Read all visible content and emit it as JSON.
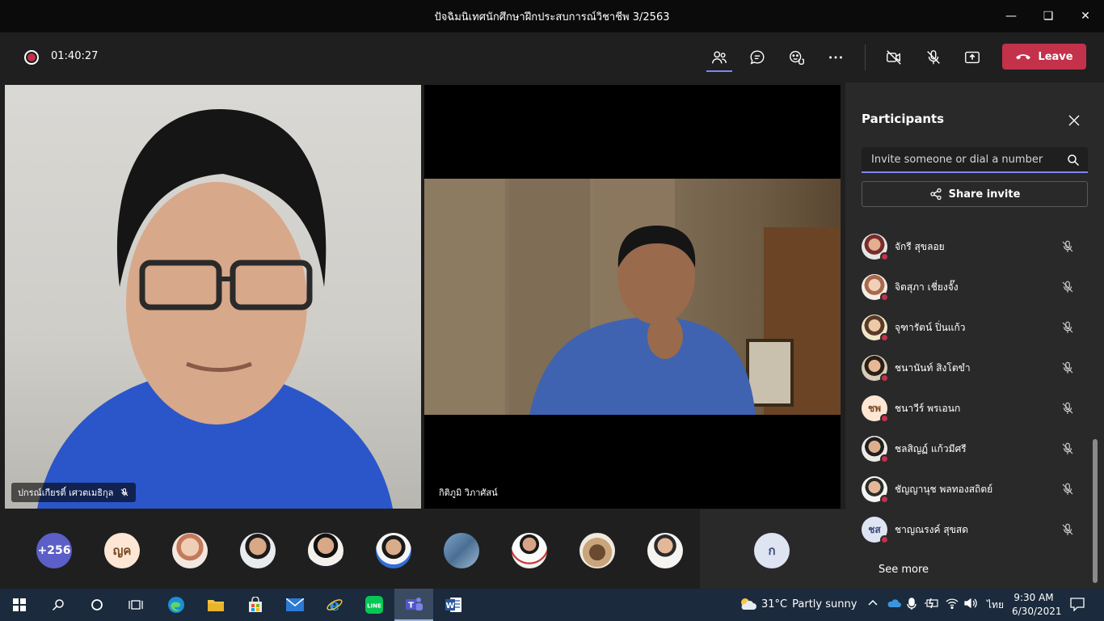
{
  "window": {
    "title": "ปัจฉิมนิเทศนักศึกษาฝึกประสบการณ์วิชาชีพ 3/2563"
  },
  "toolbar": {
    "timer": "01:40:27",
    "leave_label": "Leave"
  },
  "stage": {
    "tile1_name": "ปกรณ์เกียรติ์ เศวตเมธิกุล",
    "tile2_name": "กิติภูมิ วิภาศัสน์"
  },
  "strip": {
    "more_count": "+256",
    "avatar_initials_1": "ญค",
    "avatar_initials_last": "ก"
  },
  "panel": {
    "title": "Participants",
    "invite_placeholder": "Invite someone or dial a number",
    "share_label": "Share invite",
    "see_more": "See more",
    "participants": [
      {
        "name": "จักรี สุขลอย",
        "initials": ""
      },
      {
        "name": "จิตสุภา เชี่ยงจั๊ง",
        "initials": ""
      },
      {
        "name": "จุฑารัตน์ ปิ่นแก้ว",
        "initials": ""
      },
      {
        "name": "ชนานันท์ สิงโตขำ",
        "initials": ""
      },
      {
        "name": "ชนาวีร์ พรเอนก",
        "initials": "ชพ"
      },
      {
        "name": "ชลสิญฏ์ แก้วมีศรี",
        "initials": ""
      },
      {
        "name": "ชัญญานุช พลทองสถิตย์",
        "initials": ""
      },
      {
        "name": "ชาญณรงค์ สุขสด",
        "initials": "ชส"
      }
    ]
  },
  "taskbar": {
    "weather_temp": "31°C",
    "weather_desc": "Partly sunny",
    "lang": "ไทย",
    "time": "9:30 AM",
    "date": "6/30/2021"
  },
  "colors": {
    "accent": "#7f85f5",
    "leave": "#c4314b",
    "panel": "#292929",
    "taskbar": "#1b2a3c"
  }
}
